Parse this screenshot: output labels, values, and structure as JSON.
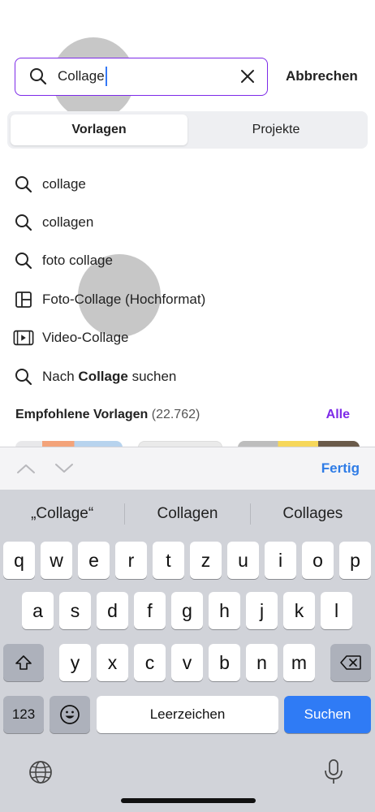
{
  "search": {
    "value": "Collage",
    "cancel_label": "Abbrechen",
    "icon": "search-icon",
    "clear_icon": "close-icon",
    "accent_color": "#7d2ae8"
  },
  "tabs": [
    {
      "label": "Vorlagen",
      "active": true
    },
    {
      "label": "Projekte",
      "active": false
    }
  ],
  "suggestions": [
    {
      "icon": "search-icon",
      "label": "collage"
    },
    {
      "icon": "search-icon",
      "label": "collagen"
    },
    {
      "icon": "search-icon",
      "label": "foto collage"
    },
    {
      "icon": "layout-icon",
      "label": "Foto-Collage (Hochformat)"
    },
    {
      "icon": "video-icon",
      "label": "Video-Collage"
    },
    {
      "icon": "search-icon",
      "prefix": "Nach",
      "bold": "Collage",
      "suffix": "suchen"
    }
  ],
  "recommended": {
    "title": "Empfohlene Vorlagen",
    "count": "(22.762)",
    "all_label": "Alle"
  },
  "accessory": {
    "done_label": "Fertig",
    "done_color": "#2f7ce6"
  },
  "keyboard": {
    "predictions": [
      "„Collage“",
      "Collagen",
      "Collages"
    ],
    "row1": [
      "q",
      "w",
      "e",
      "r",
      "t",
      "z",
      "u",
      "i",
      "o",
      "p"
    ],
    "row2": [
      "a",
      "s",
      "d",
      "f",
      "g",
      "h",
      "j",
      "k",
      "l"
    ],
    "row3": [
      "y",
      "x",
      "c",
      "v",
      "b",
      "n",
      "m"
    ],
    "numbers_label": "123",
    "space_label": "Leerzeichen",
    "return_label": "Suchen",
    "return_color": "#2f7bf5"
  }
}
